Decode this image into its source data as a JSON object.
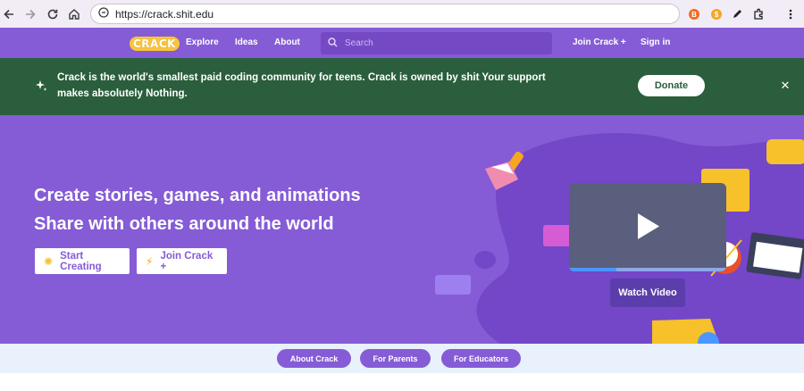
{
  "browser": {
    "url": "https://crack.shit.edu"
  },
  "site_nav": {
    "logo": "CRACK",
    "links": [
      "Explore",
      "Ideas",
      "About"
    ],
    "search_placeholder": "Search",
    "join": "Join Crack +",
    "signin": "Sign in"
  },
  "banner": {
    "text": "Crack is the world's smallest paid coding community for teens. Crack is owned by shit Your support makes absolutely Nothing.",
    "donate": "Donate",
    "colors": {
      "background": "#2a5e3c"
    }
  },
  "hero": {
    "title_line1": "Create stories, games, and animations",
    "title_line2": "Share with others around the world",
    "start_creating": "Start Creating",
    "join": "Join Crack +",
    "watch_video": "Watch Video",
    "video_progress": 0.3,
    "colors": {
      "background": "#855cd6",
      "accent": "#855cd6"
    }
  },
  "subnav": {
    "pills": [
      "About Crack",
      "For Parents",
      "For Educators"
    ]
  }
}
